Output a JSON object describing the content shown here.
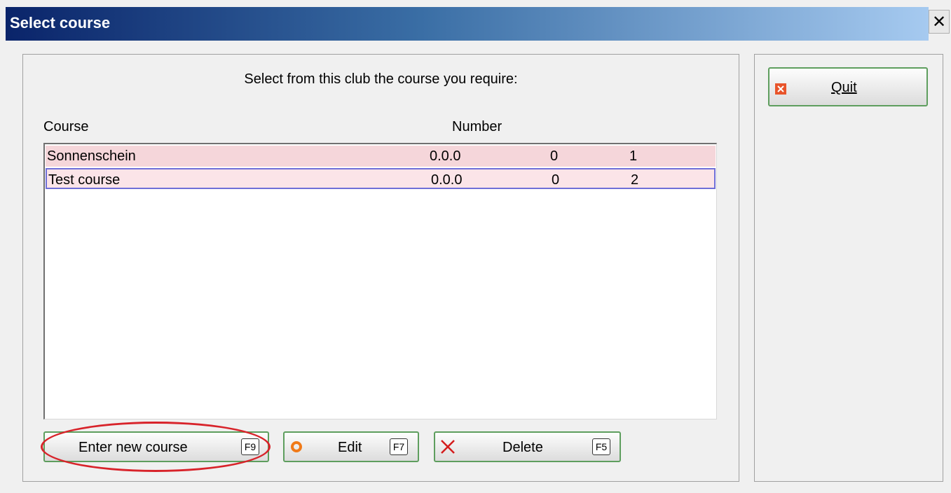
{
  "window": {
    "title": "Select course",
    "close_glyph": "✕"
  },
  "prompt": "Select from this club the course you require:",
  "columns": {
    "course": "Course",
    "number": "Number"
  },
  "rows": [
    {
      "name": "Sonnenschein",
      "number": "0.0.0",
      "a": "0",
      "b": "1"
    },
    {
      "name": "Test course",
      "number": "0.0.0",
      "a": "0",
      "b": "2"
    }
  ],
  "buttons": {
    "enter_new": {
      "label": "Enter new course",
      "key": "F9"
    },
    "edit": {
      "label": "Edit",
      "key": "F7",
      "icon": "ring-icon"
    },
    "delete": {
      "label": "Delete",
      "key": "F5",
      "icon": "x-icon"
    },
    "quit": {
      "label": "Quit",
      "icon": "quit-icon"
    }
  },
  "colors": {
    "title_gradient_start": "#0a246a",
    "title_gradient_end": "#a6caf0",
    "row1_bg": "#f5d6da",
    "row2_bg": "#fbe4e8",
    "annotation_red": "#d8232a"
  }
}
